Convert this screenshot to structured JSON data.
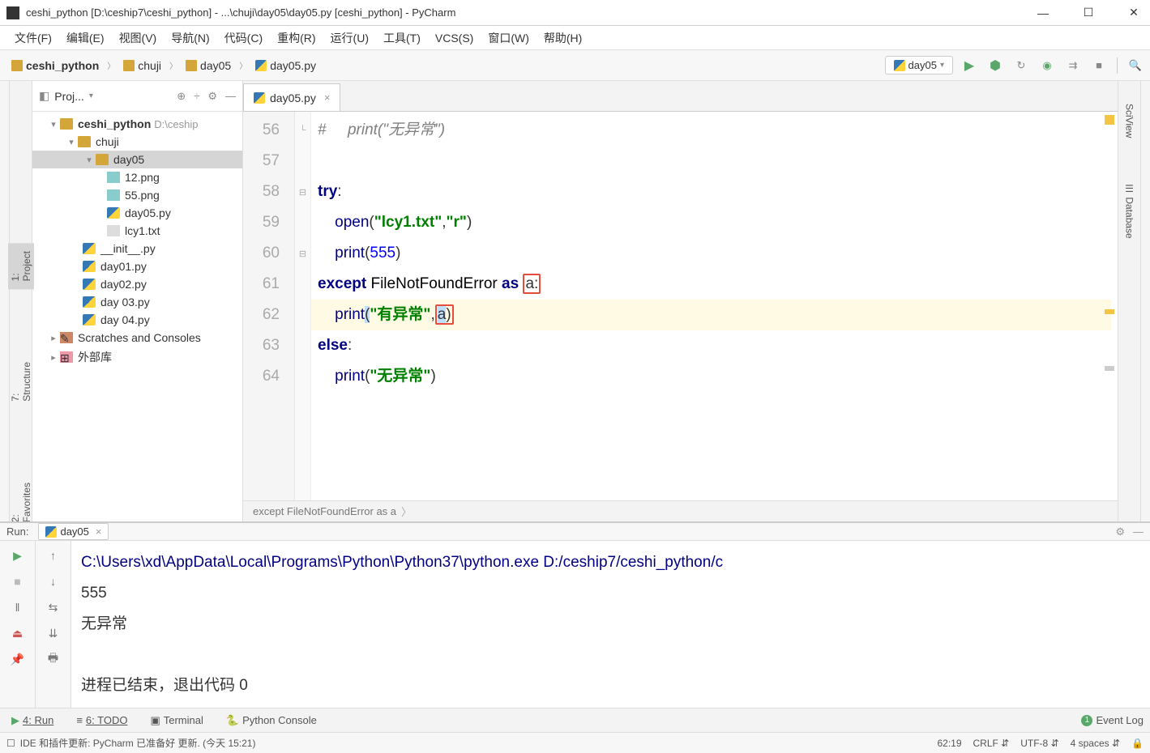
{
  "title": "ceshi_python [D:\\ceship7\\ceshi_python] - ...\\chuji\\day05\\day05.py [ceshi_python] - PyCharm",
  "menu": [
    "文件(F)",
    "编辑(E)",
    "视图(V)",
    "导航(N)",
    "代码(C)",
    "重构(R)",
    "运行(U)",
    "工具(T)",
    "VCS(S)",
    "窗口(W)",
    "帮助(H)"
  ],
  "breadcrumb": [
    "ceshi_python",
    "chuji",
    "day05",
    "day05.py"
  ],
  "run_config": "day05",
  "project_panel_title": "Proj...",
  "tree": {
    "root": "ceshi_python",
    "root_path": "D:\\ceship",
    "folder1": "chuji",
    "folder2": "day05",
    "files_day05": [
      "12.png",
      "55.png",
      "day05.py",
      "lcy1.txt"
    ],
    "files_chuji": [
      "__init__.py",
      "day01.py",
      "day02.py",
      "day 03.py",
      "day 04.py"
    ],
    "scratches": "Scratches and Consoles",
    "ext_lib": "外部库"
  },
  "editor_tab": "day05.py",
  "line_numbers": [
    "56",
    "57",
    "58",
    "59",
    "60",
    "61",
    "62",
    "63",
    "64"
  ],
  "code": {
    "l56_comment": "#     print(\"无异常\")",
    "l58_try": "try",
    "l59_open": "open",
    "l59_str1": "\"lcy1.txt\"",
    "l59_str2": "\"r\"",
    "l60_print": "print",
    "l60_val": "555",
    "l61_except": "except",
    "l61_err": "FileNotFoundError",
    "l61_as": "as",
    "l61_var": "a",
    "l62_print": "print",
    "l62_str": "\"有异常\"",
    "l62_var": "a",
    "l63_else": "else",
    "l64_print": "print",
    "l64_str": "\"无异常\""
  },
  "breadcrumb_strip": "except FileNotFoundError as a",
  "side_tabs": {
    "project": "1: Project",
    "structure": "7: Structure",
    "favorites": "2: Favorites"
  },
  "right_tabs": {
    "sciview": "SciView",
    "database": "Database"
  },
  "run_panel": {
    "label": "Run:",
    "tab": "day05",
    "path": "C:\\Users\\xd\\AppData\\Local\\Programs\\Python\\Python37\\python.exe D:/ceship7/ceshi_python/c",
    "line1": "555",
    "line2": "无异常",
    "line3": "进程已结束，退出代码 0"
  },
  "bottom_tabs": [
    "4: Run",
    "6: TODO",
    "Terminal",
    "Python Console"
  ],
  "event_log": "Event Log",
  "status_msg": "IDE 和插件更新: PyCharm 已准备好 更新. (今天 15:21)",
  "status_right": {
    "pos": "62:19",
    "eol": "CRLF",
    "enc": "UTF-8",
    "indent": "4 spaces"
  }
}
